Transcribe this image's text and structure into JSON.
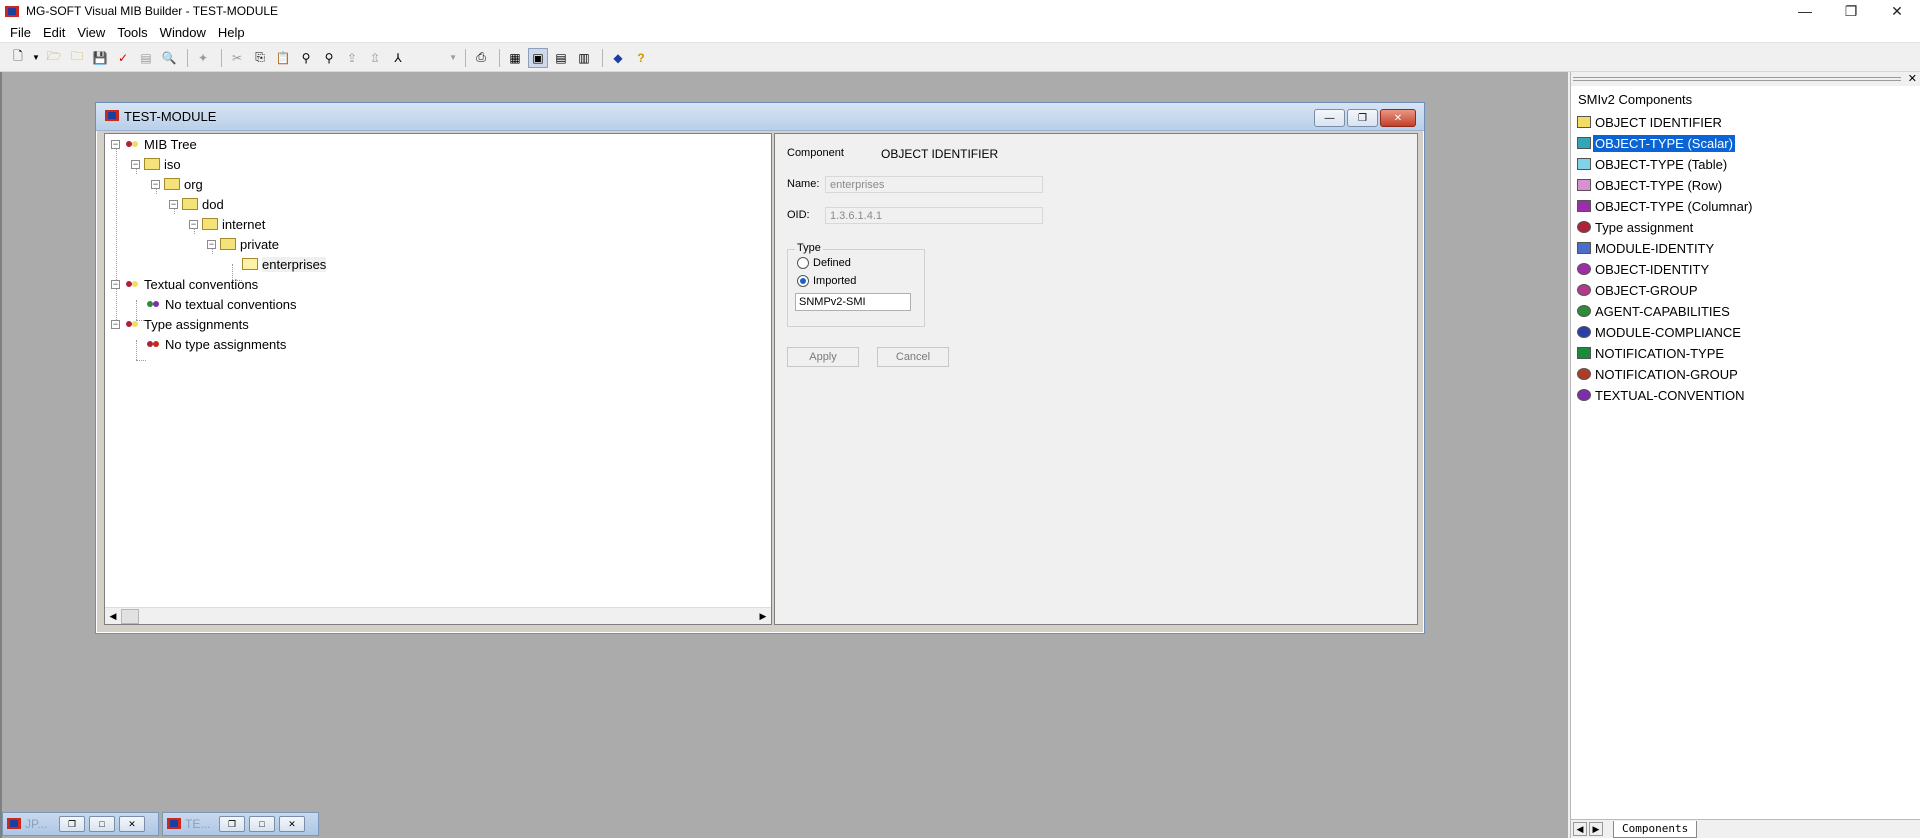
{
  "app": {
    "title": "MG-SOFT Visual MIB Builder - TEST-MODULE",
    "window_controls": [
      "—",
      "❐",
      "✕"
    ]
  },
  "menu": [
    {
      "label": "File"
    },
    {
      "label": "Edit"
    },
    {
      "label": "View"
    },
    {
      "label": "Tools"
    },
    {
      "label": "Window"
    },
    {
      "label": "Help"
    }
  ],
  "toolbar": {
    "icons": [
      "new-icon",
      "dropdown-icon",
      "open-icon",
      "open-folder-icon",
      "save-icon",
      "check-icon",
      "compile-icon",
      "preview-icon",
      "wand-icon",
      "cut-icon",
      "copy-icon",
      "paste-icon",
      "find-icon",
      "find-next-icon",
      "import-icon",
      "export-icon",
      "ref-icon",
      "print-icon",
      "view1-icon",
      "view2-icon",
      "view3-icon",
      "view4-icon",
      "about-icon",
      "help-icon"
    ]
  },
  "child_window": {
    "title": "TEST-MODULE",
    "controls": [
      "—",
      "❐",
      "✕"
    ]
  },
  "tree": {
    "items": [
      {
        "label": "MIB Tree"
      },
      {
        "label": "iso"
      },
      {
        "label": "org"
      },
      {
        "label": "dod"
      },
      {
        "label": "internet"
      },
      {
        "label": "private"
      },
      {
        "label": "enterprises"
      },
      {
        "label": "Textual conventions"
      },
      {
        "label": "No textual conventions"
      },
      {
        "label": "Type assignments"
      },
      {
        "label": "No type assignments"
      }
    ]
  },
  "details": {
    "component_label": "Component",
    "component_value": "OBJECT IDENTIFIER",
    "name_label": "Name:",
    "name_value": "enterprises",
    "oid_label": "OID:",
    "oid_value": "1.3.6.1.4.1",
    "type_group_label": "Type",
    "radio_defined": "Defined",
    "radio_imported": "Imported",
    "imported_module": "SNMPv2-SMI",
    "apply_label": "Apply",
    "cancel_label": "Cancel"
  },
  "components_panel": {
    "title": "SMIv2 Components",
    "close_glyph": "✕",
    "items": [
      {
        "label": "OBJECT IDENTIFIER",
        "color": "#f3dc66"
      },
      {
        "label": "OBJECT-TYPE (Scalar)",
        "color": "#31a7b6"
      },
      {
        "label": "OBJECT-TYPE (Table)",
        "color": "#7ed3e6"
      },
      {
        "label": "OBJECT-TYPE (Row)",
        "color": "#d98fd4"
      },
      {
        "label": "OBJECT-TYPE (Columnar)",
        "color": "#9c2fa8"
      },
      {
        "label": "Type assignment",
        "color": "#b0203a"
      },
      {
        "label": "MODULE-IDENTITY",
        "color": "#4b6cc9"
      },
      {
        "label": "OBJECT-IDENTITY",
        "color": "#9c2fa8"
      },
      {
        "label": "OBJECT-GROUP",
        "color": "#b23a8c"
      },
      {
        "label": "AGENT-CAPABILITIES",
        "color": "#2e8b3a"
      },
      {
        "label": "MODULE-COMPLIANCE",
        "color": "#2a3fa8"
      },
      {
        "label": "NOTIFICATION-TYPE",
        "color": "#1c8a3c"
      },
      {
        "label": "NOTIFICATION-GROUP",
        "color": "#b03a2a"
      },
      {
        "label": "TEXTUAL-CONVENTION",
        "color": "#7b2fa8"
      }
    ],
    "tab_label": "Components"
  },
  "minimized_windows": [
    {
      "title": "JP..."
    },
    {
      "title": "TE..."
    }
  ]
}
